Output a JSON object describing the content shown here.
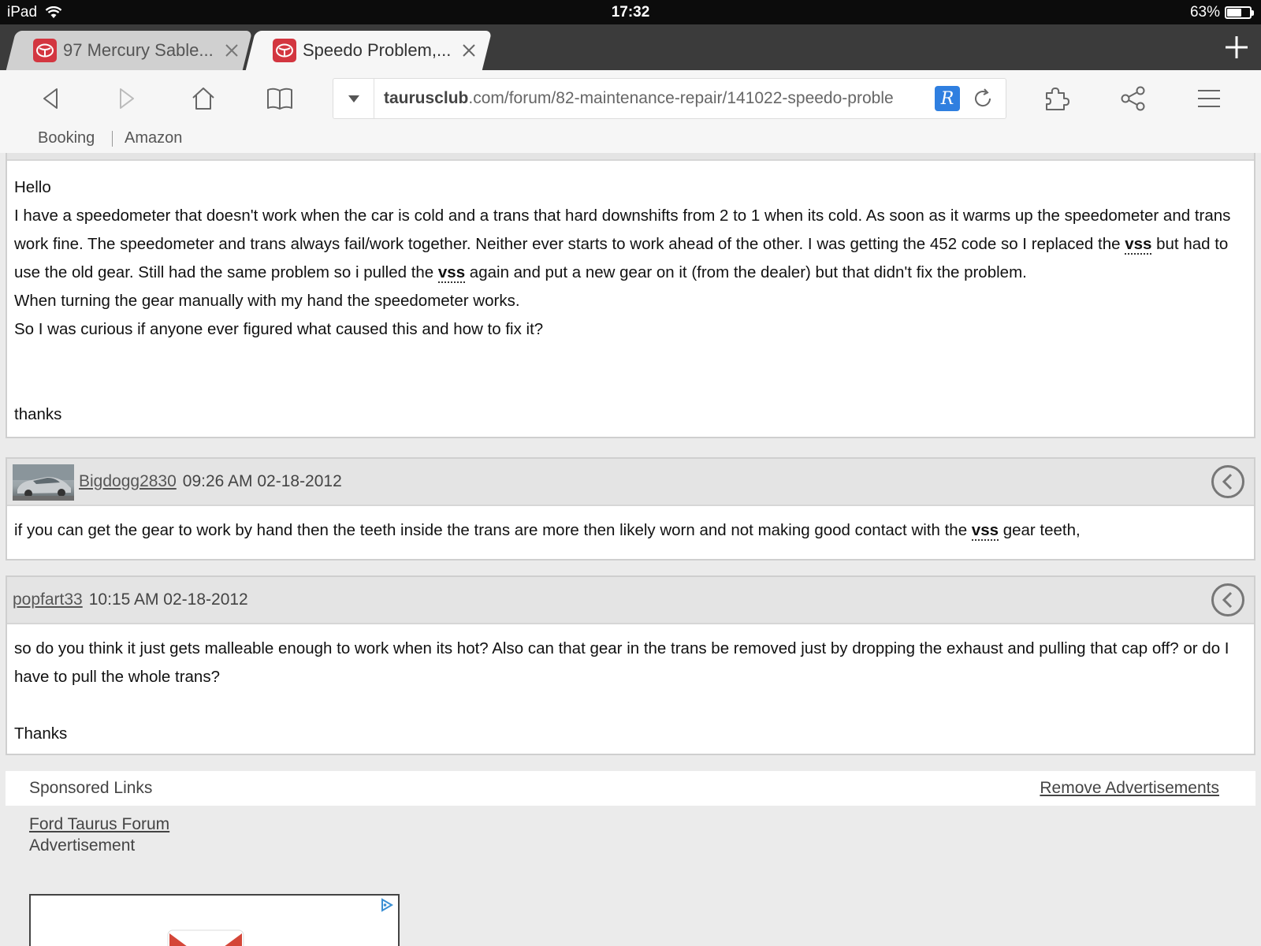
{
  "status_bar": {
    "device": "iPad",
    "time": "17:32",
    "battery": "63%",
    "battery_level": 0.63
  },
  "tabs": [
    {
      "title": "97 Mercury Sable...",
      "active": false
    },
    {
      "title": "Speedo Problem,...",
      "active": true
    }
  ],
  "toolbar": {
    "url_domain": "taurusclub",
    "url_rest": ".com/forum/82-maintenance-repair/141022-speedo-proble",
    "reader_badge": "R"
  },
  "bookmarks": [
    "Booking",
    "Amazon"
  ],
  "posts": [
    {
      "body": {
        "greeting": "Hello",
        "p1_a": "I have a speedometer that doesn't work when the car is cold and a trans that hard downshifts from 2 to 1 when its cold. As soon as it warms up the speedometer and trans work fine. The speedometer and trans always fail/work together. Neither ever starts to work ahead of the other. I was getting the 452 code so I replaced the ",
        "kw1": "vss",
        "p1_b": " but had to use the old gear. Still had the same problem so i pulled the ",
        "kw2": "vss",
        "p1_c": " again and put a new gear on it (from the dealer) but that didn't fix the problem.",
        "p2": "When turning the gear manually with my hand the speedometer works.",
        "p3": "So I was curious if anyone ever figured what caused this and how to fix it?",
        "signoff": "thanks"
      }
    },
    {
      "author": "Bigdogg2830",
      "timestamp": "09:26 AM 02-18-2012",
      "body": {
        "p1_a": "if you can get the gear to work by hand then the teeth inside the trans are more then likely worn and not making good contact with the ",
        "kw1": "vss",
        "p1_b": " gear teeth,"
      }
    },
    {
      "author": "popfart33",
      "timestamp": "10:15 AM 02-18-2012",
      "body": {
        "p1": "so do you think it just gets malleable enough to work when its hot? Also can that gear in the trans be removed just by dropping the exhaust and pulling that cap off? or do I have to pull the whole trans?",
        "signoff": "Thanks"
      }
    }
  ],
  "sponsored": {
    "label": "Sponsored Links",
    "remove": "Remove Advertisements",
    "ad_title": "Ford Taurus Forum",
    "ad_sub": "Advertisement"
  }
}
